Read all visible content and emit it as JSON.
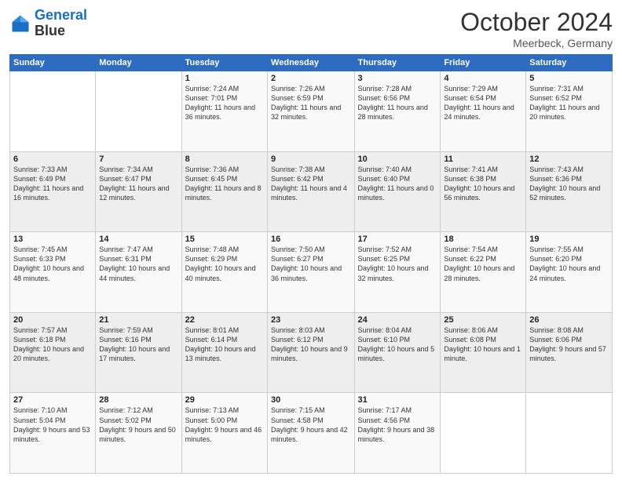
{
  "header": {
    "logo_line1": "General",
    "logo_line2": "Blue",
    "month": "October 2024",
    "location": "Meerbeck, Germany"
  },
  "days_of_week": [
    "Sunday",
    "Monday",
    "Tuesday",
    "Wednesday",
    "Thursday",
    "Friday",
    "Saturday"
  ],
  "weeks": [
    [
      {
        "day": "",
        "info": ""
      },
      {
        "day": "",
        "info": ""
      },
      {
        "day": "1",
        "info": "Sunrise: 7:24 AM\nSunset: 7:01 PM\nDaylight: 11 hours and 36 minutes."
      },
      {
        "day": "2",
        "info": "Sunrise: 7:26 AM\nSunset: 6:59 PM\nDaylight: 11 hours and 32 minutes."
      },
      {
        "day": "3",
        "info": "Sunrise: 7:28 AM\nSunset: 6:56 PM\nDaylight: 11 hours and 28 minutes."
      },
      {
        "day": "4",
        "info": "Sunrise: 7:29 AM\nSunset: 6:54 PM\nDaylight: 11 hours and 24 minutes."
      },
      {
        "day": "5",
        "info": "Sunrise: 7:31 AM\nSunset: 6:52 PM\nDaylight: 11 hours and 20 minutes."
      }
    ],
    [
      {
        "day": "6",
        "info": "Sunrise: 7:33 AM\nSunset: 6:49 PM\nDaylight: 11 hours and 16 minutes."
      },
      {
        "day": "7",
        "info": "Sunrise: 7:34 AM\nSunset: 6:47 PM\nDaylight: 11 hours and 12 minutes."
      },
      {
        "day": "8",
        "info": "Sunrise: 7:36 AM\nSunset: 6:45 PM\nDaylight: 11 hours and 8 minutes."
      },
      {
        "day": "9",
        "info": "Sunrise: 7:38 AM\nSunset: 6:42 PM\nDaylight: 11 hours and 4 minutes."
      },
      {
        "day": "10",
        "info": "Sunrise: 7:40 AM\nSunset: 6:40 PM\nDaylight: 11 hours and 0 minutes."
      },
      {
        "day": "11",
        "info": "Sunrise: 7:41 AM\nSunset: 6:38 PM\nDaylight: 10 hours and 56 minutes."
      },
      {
        "day": "12",
        "info": "Sunrise: 7:43 AM\nSunset: 6:36 PM\nDaylight: 10 hours and 52 minutes."
      }
    ],
    [
      {
        "day": "13",
        "info": "Sunrise: 7:45 AM\nSunset: 6:33 PM\nDaylight: 10 hours and 48 minutes."
      },
      {
        "day": "14",
        "info": "Sunrise: 7:47 AM\nSunset: 6:31 PM\nDaylight: 10 hours and 44 minutes."
      },
      {
        "day": "15",
        "info": "Sunrise: 7:48 AM\nSunset: 6:29 PM\nDaylight: 10 hours and 40 minutes."
      },
      {
        "day": "16",
        "info": "Sunrise: 7:50 AM\nSunset: 6:27 PM\nDaylight: 10 hours and 36 minutes."
      },
      {
        "day": "17",
        "info": "Sunrise: 7:52 AM\nSunset: 6:25 PM\nDaylight: 10 hours and 32 minutes."
      },
      {
        "day": "18",
        "info": "Sunrise: 7:54 AM\nSunset: 6:22 PM\nDaylight: 10 hours and 28 minutes."
      },
      {
        "day": "19",
        "info": "Sunrise: 7:55 AM\nSunset: 6:20 PM\nDaylight: 10 hours and 24 minutes."
      }
    ],
    [
      {
        "day": "20",
        "info": "Sunrise: 7:57 AM\nSunset: 6:18 PM\nDaylight: 10 hours and 20 minutes."
      },
      {
        "day": "21",
        "info": "Sunrise: 7:59 AM\nSunset: 6:16 PM\nDaylight: 10 hours and 17 minutes."
      },
      {
        "day": "22",
        "info": "Sunrise: 8:01 AM\nSunset: 6:14 PM\nDaylight: 10 hours and 13 minutes."
      },
      {
        "day": "23",
        "info": "Sunrise: 8:03 AM\nSunset: 6:12 PM\nDaylight: 10 hours and 9 minutes."
      },
      {
        "day": "24",
        "info": "Sunrise: 8:04 AM\nSunset: 6:10 PM\nDaylight: 10 hours and 5 minutes."
      },
      {
        "day": "25",
        "info": "Sunrise: 8:06 AM\nSunset: 6:08 PM\nDaylight: 10 hours and 1 minute."
      },
      {
        "day": "26",
        "info": "Sunrise: 8:08 AM\nSunset: 6:06 PM\nDaylight: 9 hours and 57 minutes."
      }
    ],
    [
      {
        "day": "27",
        "info": "Sunrise: 7:10 AM\nSunset: 5:04 PM\nDaylight: 9 hours and 53 minutes."
      },
      {
        "day": "28",
        "info": "Sunrise: 7:12 AM\nSunset: 5:02 PM\nDaylight: 9 hours and 50 minutes."
      },
      {
        "day": "29",
        "info": "Sunrise: 7:13 AM\nSunset: 5:00 PM\nDaylight: 9 hours and 46 minutes."
      },
      {
        "day": "30",
        "info": "Sunrise: 7:15 AM\nSunset: 4:58 PM\nDaylight: 9 hours and 42 minutes."
      },
      {
        "day": "31",
        "info": "Sunrise: 7:17 AM\nSunset: 4:56 PM\nDaylight: 9 hours and 38 minutes."
      },
      {
        "day": "",
        "info": ""
      },
      {
        "day": "",
        "info": ""
      }
    ]
  ]
}
